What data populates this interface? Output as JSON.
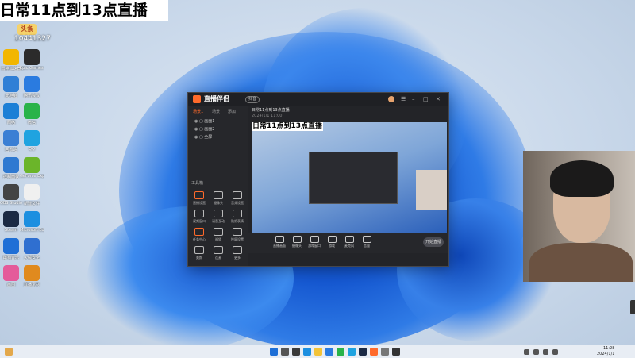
{
  "overlay": {
    "title": "日常11点到13点直播",
    "room_id": "10441327",
    "badge": "头条"
  },
  "desktop_icons": [
    {
      "name": "leigod-icon",
      "label": "雷神加速器"
    },
    {
      "name": "epic-icon",
      "label": "Epic Games Launcher"
    },
    {
      "name": "this-pc-icon",
      "label": "此电脑"
    },
    {
      "name": "tencent-meeting-icon",
      "label": "腾讯会议"
    },
    {
      "name": "network-icon",
      "label": "网络"
    },
    {
      "name": "wechat-icon",
      "label": "微信"
    },
    {
      "name": "recycle-bin-icon",
      "label": "回收站"
    },
    {
      "name": "qq-icon",
      "label": "QQ"
    },
    {
      "name": "control-panel-icon",
      "label": "控制面板"
    },
    {
      "name": "geforce-icon",
      "label": "GeForce Experience"
    },
    {
      "name": "obs-icon",
      "label": "OBS Studio"
    },
    {
      "name": "file-icon",
      "label": "新建文件"
    },
    {
      "name": "steam-icon",
      "label": "Steam"
    },
    {
      "name": "edge-icon",
      "label": "Microsoft Edge"
    },
    {
      "name": "kugou-icon",
      "label": "酷狗音乐"
    },
    {
      "name": "security-icon",
      "label": "火绒安全"
    },
    {
      "name": "color-icon",
      "label": "画图"
    },
    {
      "name": "folder-icon",
      "label": "直播素材"
    }
  ],
  "app": {
    "name": "直播伴侣",
    "tag": "抖音",
    "side_tabs": [
      "场景1",
      "场景",
      "添加"
    ],
    "scenes": [
      "画面1",
      "画面2",
      "全屏"
    ],
    "tools_heading": "工具箱",
    "tools": [
      "直播设置",
      "摄像头",
      "音频设置",
      "视频窗口",
      "语音互动",
      "贴纸表情",
      "任务中心",
      "福袋",
      "投屏设置",
      "美颜",
      "连麦",
      "更多"
    ],
    "stream_title": "日常11点到13点直播",
    "stream_sub": "2024/1/1  11:00",
    "preview_title": "日常11点到13点直播",
    "bottom": [
      "直播画面",
      "摄像头",
      "游戏窗口",
      "游戏",
      "麦克风",
      "音量"
    ],
    "start_button": "开始直播",
    "status": "已连接"
  },
  "taskbar": {
    "time": "11:28",
    "date": "2024/1/1"
  }
}
